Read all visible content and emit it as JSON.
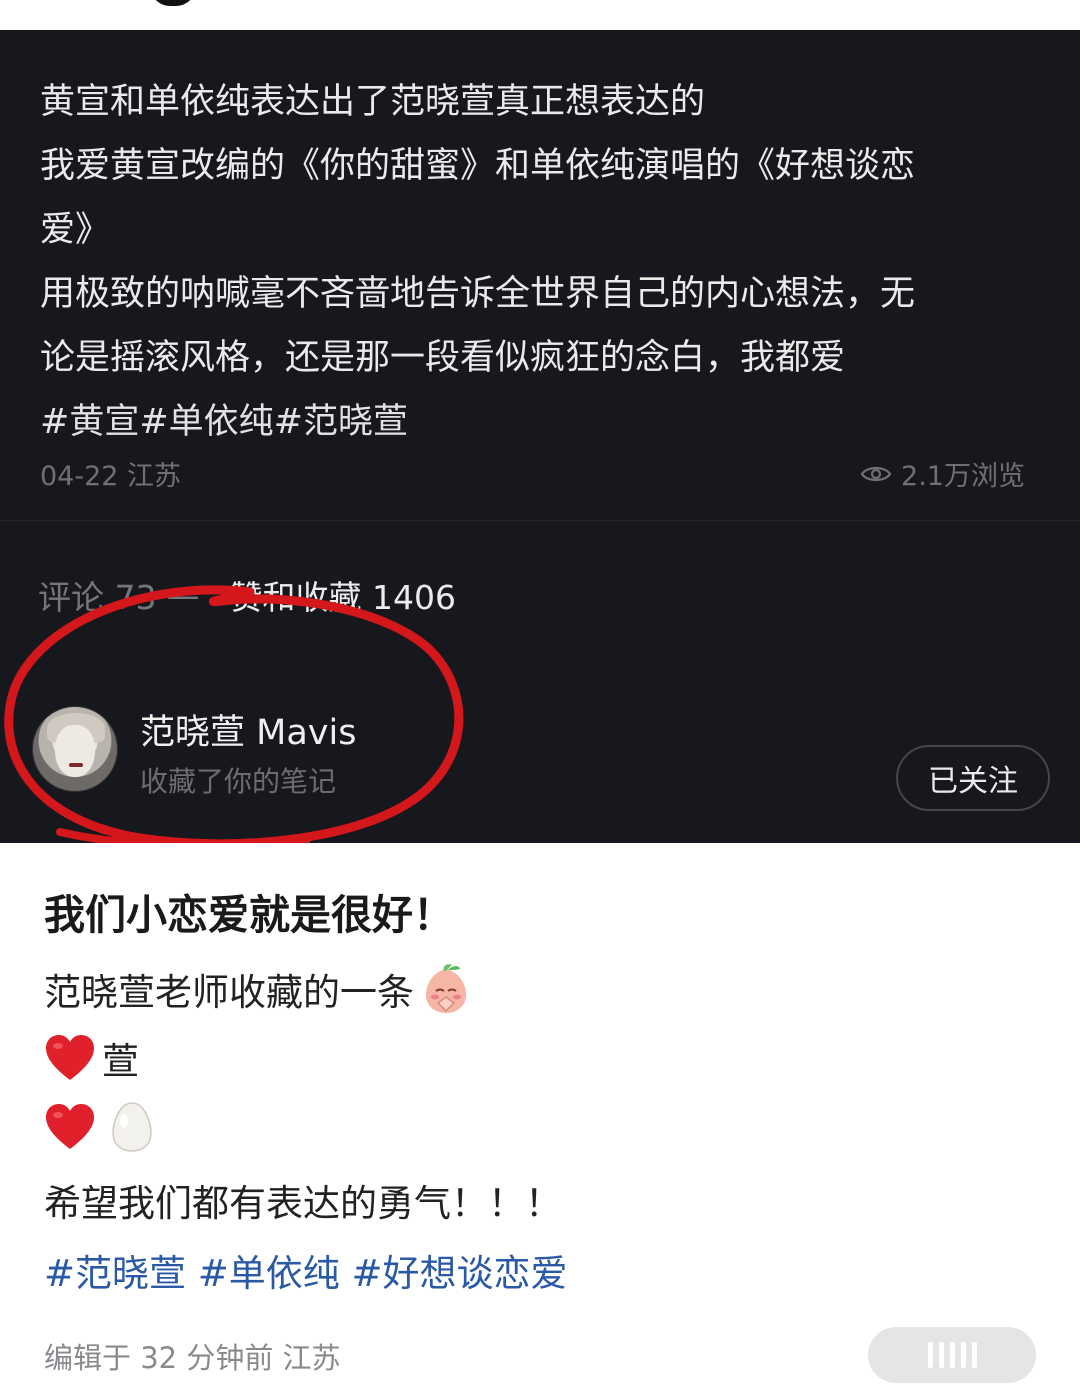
{
  "post": {
    "lines": [
      "黄宣和单依纯表达出了范晓萱真正想表达的",
      "我爱黄宣改编的《你的甜蜜》和单依纯演唱的《好想谈恋",
      "爱》",
      "用极致的呐喊毫不吝啬地告诉全世界自己的内心想法，无",
      "论是摇滚风格，还是那一段看似疯狂的念白，我都爱"
    ],
    "tags": "#黄宣#单依纯#范晓萱",
    "date_location": "04-22 江苏",
    "views": "2.1万浏览",
    "eye_icon": "eye-icon"
  },
  "stats": {
    "comments": "评论 73",
    "likes_collects": "赞和收藏 1406"
  },
  "notification": {
    "user_name": "范晓萱 Mavis",
    "action": "收藏了你的笔记",
    "follow_label": "已关注"
  },
  "caption": {
    "title": "我们小恋爱就是很好！",
    "line1": "范晓萱老师收藏的一条",
    "line2_text": "萱",
    "line4": "希望我们都有表达的勇气！！！",
    "tags": "#范晓萱 #单依纯 #好想谈恋爱",
    "meta": "编辑于 32 分钟前 江苏",
    "emoji": [
      "peach-pray-emoji",
      "red-heart-emoji",
      "egg-emoji"
    ]
  },
  "colors": {
    "dark_bg": "#17181d",
    "annotation_red": "#d4171b",
    "tag_blue": "#2a5aa6"
  }
}
